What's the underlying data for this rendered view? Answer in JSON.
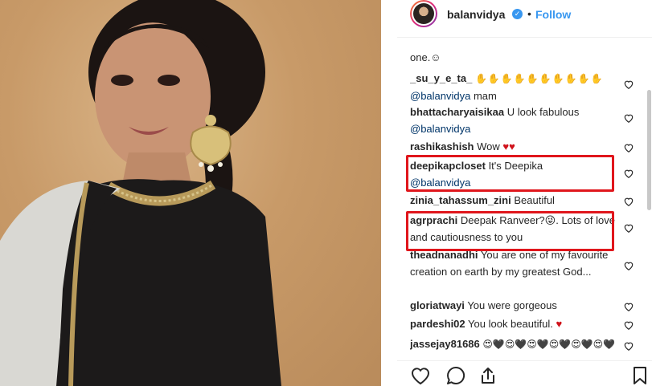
{
  "post": {
    "username": "balanvidya",
    "verified_symbol": "✓",
    "separator": "•",
    "follow_label": "Follow"
  },
  "comments": {
    "clipped_top_text": "one.☺",
    "items": [
      {
        "user": "_su_y_e_ta_",
        "text": "✋✋✋✋✋✋✋✋✋✋",
        "mention": "@balanvidya",
        "tail": " mam"
      },
      {
        "user": "bhattacharyaisikaa",
        "text": "U look fabulous",
        "mention": "@balanvidya",
        "tail": ""
      },
      {
        "user": "rashikashish",
        "text": "Wow",
        "hearts": "♥♥"
      },
      {
        "user": "deepikapcloset",
        "text": "It's Deepika",
        "mention": "@balanvidya",
        "tail": ""
      },
      {
        "user": "zinia_tahassum_zini",
        "text": "Beautiful"
      },
      {
        "user": "agrprachi",
        "text": "Deepak Ranveer?😜. Lots of love and cautiousness to you"
      },
      {
        "user": "theadnanadhi",
        "text": "You are one of my favourite creation on earth by my greatest God..."
      },
      {
        "user": "gloriatwayi",
        "text": "You were gorgeous"
      },
      {
        "user": "pardeshi02",
        "text": "You look beautiful.",
        "hearts": "♥"
      },
      {
        "user": "jassejay81686",
        "text": "😍🖤😍🖤😍🖤😍🖤😍🖤😍🖤"
      }
    ]
  },
  "icons": {
    "like": "heart-outline-icon",
    "comment": "speech-bubble-icon",
    "share": "share-upload-icon",
    "save": "bookmark-icon"
  },
  "colors": {
    "follow": "#3897f0",
    "highlight": "#e0161c",
    "mention": "#003569"
  }
}
